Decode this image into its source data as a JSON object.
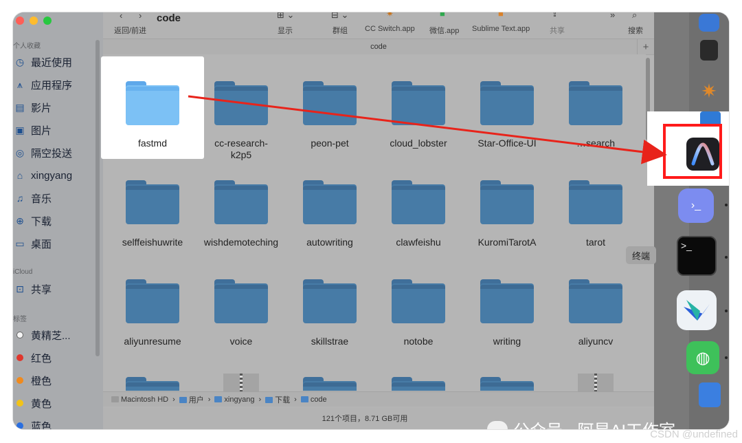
{
  "window": {
    "traffic_colors": [
      "#ff5f57",
      "#febc2e",
      "#28c840"
    ]
  },
  "toolbar": {
    "nav_label": "返回/前进",
    "folder_title": "code",
    "view_label": "显示",
    "group_label": "群组",
    "app1": "CC Switch.app",
    "app2": "微信.app",
    "app3": "Sublime Text.app",
    "share_label": "共享",
    "search_label": "搜索"
  },
  "path_title": "code",
  "sidebar": {
    "favorites_header": "个人收藏",
    "favorites": [
      {
        "icon": "clock-icon",
        "label": "最近使用"
      },
      {
        "icon": "apps-icon",
        "label": "应用程序"
      },
      {
        "icon": "film-icon",
        "label": "影片"
      },
      {
        "icon": "photo-icon",
        "label": "图片"
      },
      {
        "icon": "airdrop-icon",
        "label": "隔空投送"
      },
      {
        "icon": "home-icon",
        "label": "xingyang"
      },
      {
        "icon": "music-icon",
        "label": "音乐"
      },
      {
        "icon": "download-icon",
        "label": "下载"
      },
      {
        "icon": "desktop-icon",
        "label": "桌面"
      }
    ],
    "icloud_header": "iCloud",
    "icloud_items": [
      {
        "icon": "share-folder-icon",
        "label": "共享"
      }
    ],
    "tags_header": "标签",
    "tags": [
      {
        "color": "#f5f5f5",
        "label": "黄精芝..."
      },
      {
        "color": "#e0362c",
        "label": "红色"
      },
      {
        "color": "#f08a1d",
        "label": "橙色"
      },
      {
        "color": "#f2c318",
        "label": "黄色"
      },
      {
        "color": "#2a6fe0",
        "label": "蓝色"
      }
    ]
  },
  "files": [
    "fastmd",
    "cc-research-k2p5",
    "peon-pet",
    "cloud_lobster",
    "Star-Office-UI",
    "agent-search",
    "selffeishuwrite",
    "wishdemoteching",
    "autowriting",
    "clawfeishu",
    "KuromiTarotA",
    "tarot",
    "aliyunresume",
    "voice",
    "skillstrae",
    "notobe",
    "writing",
    "aliyuncv"
  ],
  "visible_labels": {
    "cc-research-k2p5": "cc-research-\nk2p5",
    "Star-Office-UI": "Star-Office-UI",
    "agent-search": "…search"
  },
  "pathbar": {
    "segments": [
      "Macintosh HD",
      "用户",
      "xingyang",
      "下载",
      "code"
    ]
  },
  "status": "121个项目，8.71 GB可用",
  "dock": {
    "tooltip": "终端"
  },
  "watermark": {
    "text": "公众号 · 阿星AI工作室",
    "csdn": "CSDN @undefined"
  },
  "colors": {
    "arrow": "#e8231a",
    "highlight_border": "#ff1a1a"
  }
}
